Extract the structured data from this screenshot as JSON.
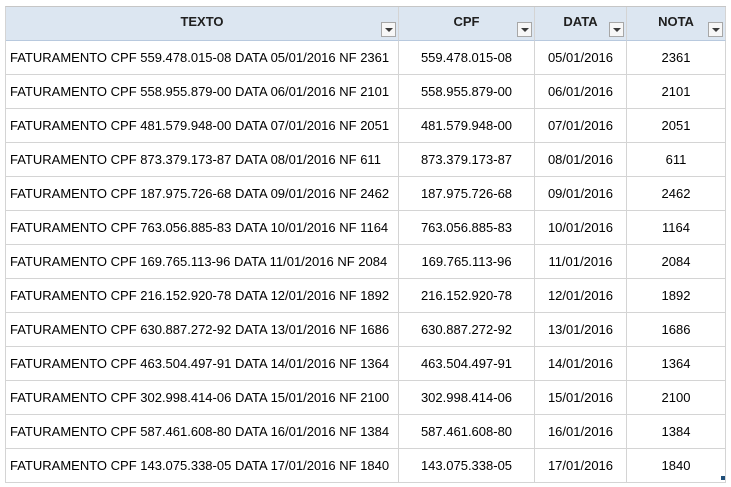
{
  "table": {
    "headers": [
      "TEXTO",
      "CPF",
      "DATA",
      "NOTA"
    ],
    "rows": [
      [
        "FATURAMENTO CPF 559.478.015-08 DATA 05/01/2016 NF 2361",
        "559.478.015-08",
        "05/01/2016",
        "2361"
      ],
      [
        "FATURAMENTO CPF 558.955.879-00 DATA 06/01/2016 NF 2101",
        "558.955.879-00",
        "06/01/2016",
        "2101"
      ],
      [
        "FATURAMENTO CPF 481.579.948-00 DATA 07/01/2016 NF 2051",
        "481.579.948-00",
        "07/01/2016",
        "2051"
      ],
      [
        "FATURAMENTO CPF 873.379.173-87 DATA 08/01/2016 NF 611",
        "873.379.173-87",
        "08/01/2016",
        "611"
      ],
      [
        "FATURAMENTO CPF 187.975.726-68 DATA 09/01/2016 NF 2462",
        "187.975.726-68",
        "09/01/2016",
        "2462"
      ],
      [
        "FATURAMENTO CPF 763.056.885-83 DATA 10/01/2016 NF 1164",
        "763.056.885-83",
        "10/01/2016",
        "1164"
      ],
      [
        "FATURAMENTO CPF 169.765.113-96 DATA 11/01/2016 NF 2084",
        "169.765.113-96",
        "11/01/2016",
        "2084"
      ],
      [
        "FATURAMENTO CPF 216.152.920-78 DATA 12/01/2016 NF 1892",
        "216.152.920-78",
        "12/01/2016",
        "1892"
      ],
      [
        "FATURAMENTO CPF 630.887.272-92 DATA 13/01/2016 NF 1686",
        "630.887.272-92",
        "13/01/2016",
        "1686"
      ],
      [
        "FATURAMENTO CPF 463.504.497-91 DATA 14/01/2016 NF 1364",
        "463.504.497-91",
        "14/01/2016",
        "1364"
      ],
      [
        "FATURAMENTO CPF 302.998.414-06 DATA 15/01/2016 NF 2100",
        "302.998.414-06",
        "15/01/2016",
        "2100"
      ],
      [
        "FATURAMENTO CPF 587.461.608-80 DATA 16/01/2016 NF 1384",
        "587.461.608-80",
        "16/01/2016",
        "1384"
      ],
      [
        "FATURAMENTO CPF 143.075.338-05 DATA 17/01/2016 NF 1840",
        "143.075.338-05",
        "17/01/2016",
        "1840"
      ]
    ]
  },
  "icons": {
    "filter": "filter-dropdown-icon"
  },
  "colors": {
    "header_bg": "#dce6f1",
    "grid_line": "#d4d4d4",
    "resize_handle": "#1f4e79"
  }
}
